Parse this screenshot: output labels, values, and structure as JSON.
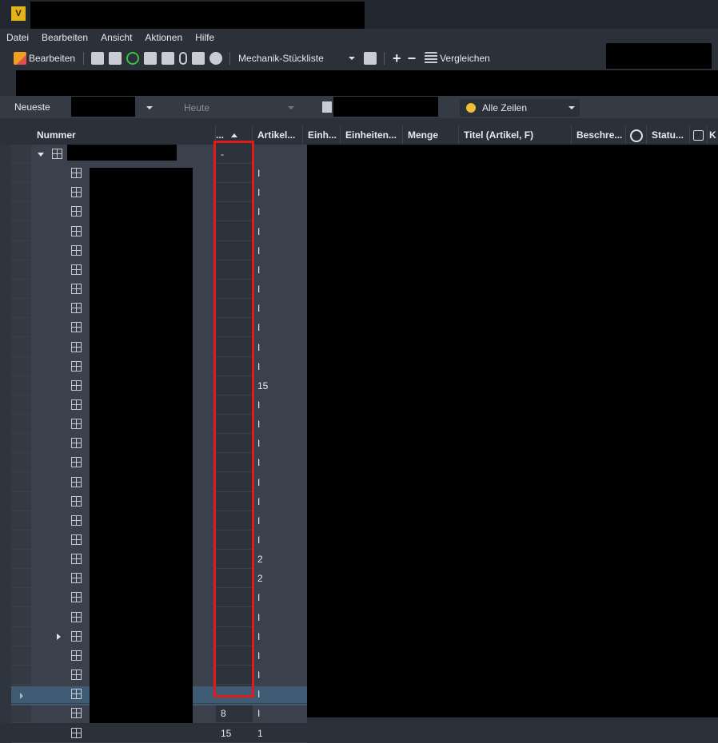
{
  "app": {
    "icon_letter": "V"
  },
  "menu": [
    "Datei",
    "Bearbeiten",
    "Ansicht",
    "Aktionen",
    "Hilfe"
  ],
  "toolbar": {
    "edit_label": "Bearbeiten",
    "bom_label": "Mechanik-Stückliste",
    "compare_label": "Vergleichen"
  },
  "filters": {
    "newest": "Neueste",
    "today": "Heute",
    "all_rows": "Alle Zeilen"
  },
  "columns": [
    "Nummer",
    "...",
    "Artikel...",
    "Einh...",
    "Einheiten...",
    "Menge",
    "Titel (Artikel, F)",
    "Beschre...",
    "Statu...",
    "K"
  ],
  "rows": [
    {
      "b": "-",
      "c": ""
    },
    {
      "b": "",
      "c": "I"
    },
    {
      "b": "",
      "c": "I"
    },
    {
      "b": "",
      "c": "I"
    },
    {
      "b": "",
      "c": "I"
    },
    {
      "b": "",
      "c": "I"
    },
    {
      "b": "",
      "c": "I"
    },
    {
      "b": "",
      "c": "I"
    },
    {
      "b": "",
      "c": "I"
    },
    {
      "b": "",
      "c": "I"
    },
    {
      "b": "",
      "c": "I"
    },
    {
      "b": "",
      "c": "I"
    },
    {
      "b": "",
      "c": "15"
    },
    {
      "b": "",
      "c": "I"
    },
    {
      "b": "",
      "c": "I"
    },
    {
      "b": "",
      "c": "I"
    },
    {
      "b": "",
      "c": "I"
    },
    {
      "b": "",
      "c": "I"
    },
    {
      "b": "",
      "c": "I"
    },
    {
      "b": "",
      "c": "I"
    },
    {
      "b": "",
      "c": "I"
    },
    {
      "b": "",
      "c": "2"
    },
    {
      "b": "",
      "c": "2"
    },
    {
      "b": "",
      "c": "I"
    },
    {
      "b": "",
      "c": "I"
    },
    {
      "b": "",
      "c": "I"
    },
    {
      "b": "",
      "c": "I"
    },
    {
      "b": "",
      "c": "I"
    },
    {
      "b": "",
      "c": "I"
    },
    {
      "b": "8",
      "c": "I"
    },
    {
      "b": "15",
      "c": "1"
    }
  ],
  "colors": {
    "highlight": "#e11b1b",
    "selected_row": "#3f5a73"
  }
}
